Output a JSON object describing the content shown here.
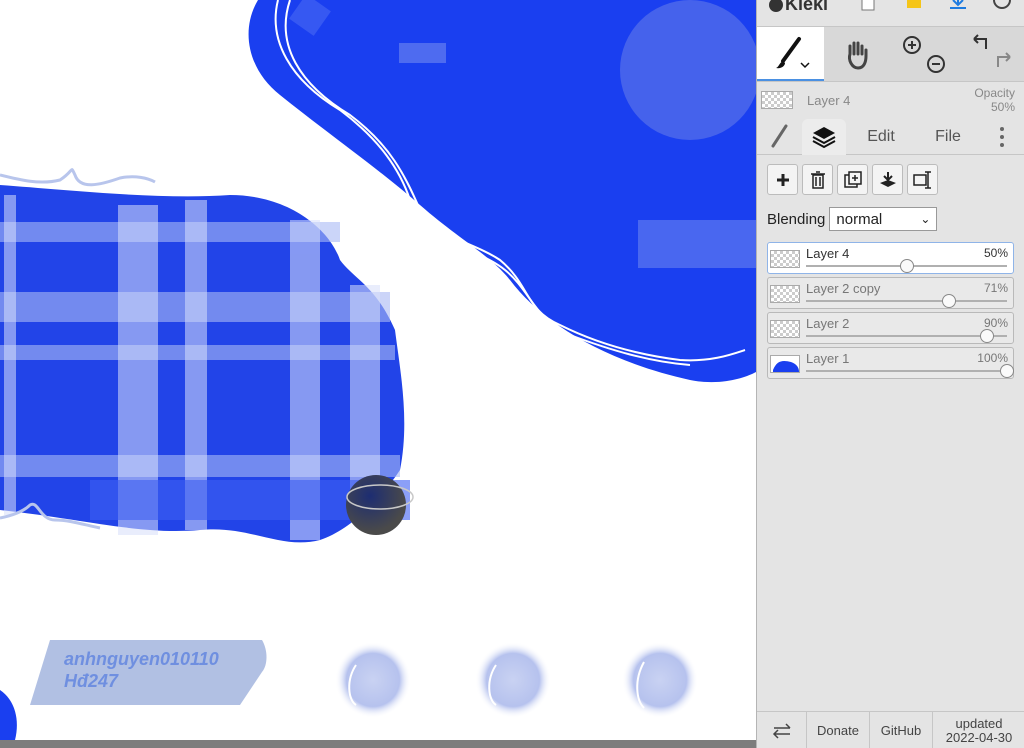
{
  "app": {
    "name": "Kleki"
  },
  "canvas": {
    "signature_line1": "anhnguyen010110",
    "signature_line2": "Hđ247"
  },
  "current_layer": {
    "name": "Layer 4",
    "opacity_label": "Opacity",
    "opacity_value": "50%"
  },
  "tabs": {
    "edit": "Edit",
    "file": "File"
  },
  "blending": {
    "label": "Blending",
    "value": "normal"
  },
  "layers": [
    {
      "name": "Layer 4",
      "opacity": "50%",
      "fraction": 0.5
    },
    {
      "name": "Layer 2 copy",
      "opacity": "71%",
      "fraction": 0.71
    },
    {
      "name": "Layer 2",
      "opacity": "90%",
      "fraction": 0.9
    },
    {
      "name": "Layer 1",
      "opacity": "100%",
      "fraction": 1.0
    }
  ],
  "footer": {
    "donate": "Donate",
    "github": "GitHub",
    "updated_label": "updated",
    "updated_date": "2022-04-30"
  },
  "colors": {
    "brush_blue": "#1a3ff0",
    "panel_bg": "#e4e4e4",
    "accent": "#4a90e2"
  },
  "icons": {
    "brush": "brush-icon",
    "hand": "hand-icon",
    "zoom_in": "zoom-in-icon",
    "zoom_out": "zoom-out-icon",
    "undo": "undo-icon",
    "redo": "redo-icon",
    "layers": "layers-icon",
    "more": "more-icon",
    "add": "add-layer-icon",
    "delete": "delete-layer-icon",
    "duplicate": "duplicate-layer-icon",
    "merge": "merge-down-icon",
    "rename": "rename-icon",
    "swap": "swap-icon"
  }
}
